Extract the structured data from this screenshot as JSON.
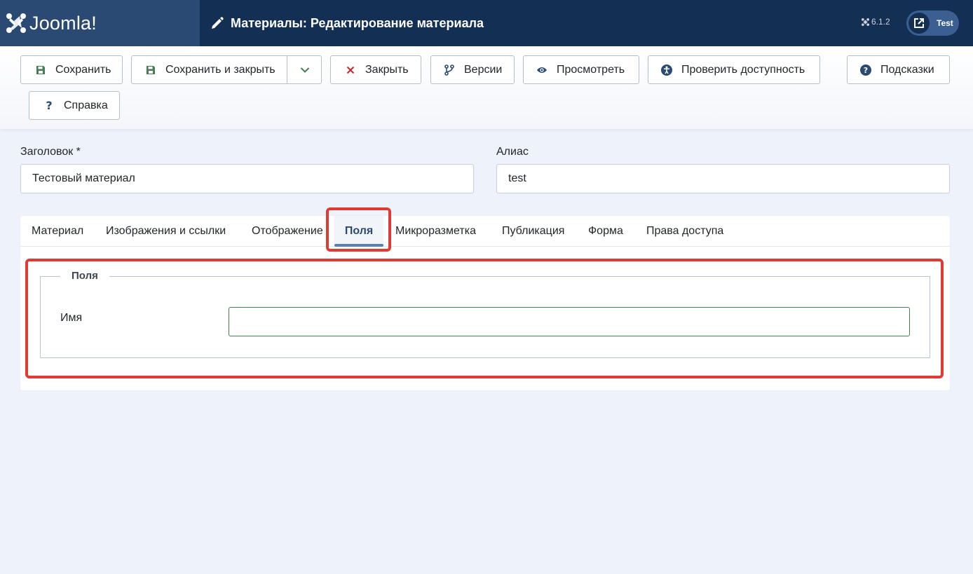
{
  "header": {
    "logo_text": "Joomla!",
    "title": "Материалы: Редактирование материала",
    "version": "6.1.2",
    "user_label": "Test"
  },
  "toolbar": {
    "save": "Сохранить",
    "save_close": "Сохранить и закрыть",
    "close": "Закрыть",
    "versions": "Версии",
    "preview": "Просмотреть",
    "accessibility": "Проверить доступность",
    "hints": "Подсказки",
    "help": "Справка"
  },
  "form": {
    "title_label": "Заголовок *",
    "title_value": "Тестовый материал",
    "alias_label": "Алиас",
    "alias_value": "test"
  },
  "tabs": [
    {
      "label": "Материал"
    },
    {
      "label": "Изображения и ссылки"
    },
    {
      "label": "Отображение"
    },
    {
      "label": "Поля"
    },
    {
      "label": "Микроразметка"
    },
    {
      "label": "Публикация"
    },
    {
      "label": "Форма"
    },
    {
      "label": "Права доступа"
    }
  ],
  "fields_panel": {
    "legend": "Поля",
    "name_label": "Имя",
    "name_value": ""
  },
  "colors": {
    "header_bg": "#132f53",
    "accent": "#5a7fae",
    "highlight": "#e03a35"
  }
}
